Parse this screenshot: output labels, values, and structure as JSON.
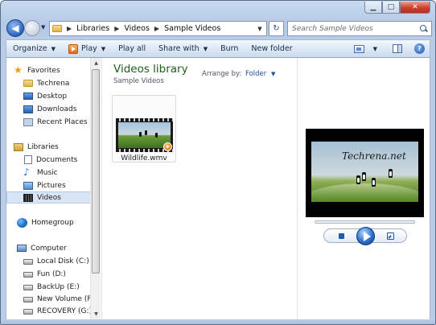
{
  "window": {
    "caption_buttons": [
      {
        "name": "minimize",
        "glyph": "▁"
      },
      {
        "name": "maximize",
        "glyph": "□"
      },
      {
        "name": "close",
        "glyph": "✕"
      }
    ]
  },
  "nav": {
    "back_glyph": "◀",
    "breadcrumbs": [
      "Libraries",
      "Videos",
      "Sample Videos"
    ],
    "breadcrumb_sep": "▶",
    "dropdown_glyph": "▼",
    "refresh_glyph": "↻",
    "search_placeholder": "Search Sample Videos"
  },
  "toolbar": {
    "organize": "Organize",
    "play": "Play",
    "play_all": "Play all",
    "share_with": "Share with",
    "burn": "Burn",
    "new_folder": "New folder",
    "caret": "▼",
    "help_glyph": "?"
  },
  "sidebar": {
    "groups": [
      {
        "label": "Favorites",
        "icon": "star-icon"
      },
      {
        "label": "Libraries",
        "icon": "library-icon"
      },
      {
        "label": "Homegroup",
        "icon": "homegroup-icon"
      },
      {
        "label": "Computer",
        "icon": "computer-icon"
      }
    ],
    "favorites": [
      {
        "label": "Techrena",
        "icon": "folder-icon"
      },
      {
        "label": "Desktop",
        "icon": "desktop-icon"
      },
      {
        "label": "Downloads",
        "icon": "downloads-icon"
      },
      {
        "label": "Recent Places",
        "icon": "recent-places-icon"
      }
    ],
    "libraries": [
      {
        "label": "Documents",
        "icon": "documents-icon"
      },
      {
        "label": "Music",
        "icon": "music-icon"
      },
      {
        "label": "Pictures",
        "icon": "pictures-icon"
      },
      {
        "label": "Videos",
        "icon": "videos-icon",
        "selected": true
      }
    ],
    "drives": [
      {
        "label": "Local Disk (C:)",
        "icon": "local-disk-icon"
      },
      {
        "label": "Fun (D:)",
        "icon": "drive-icon"
      },
      {
        "label": "BackUp (E:)",
        "icon": "drive-icon"
      },
      {
        "label": "New Volume (F:)",
        "icon": "drive-icon"
      },
      {
        "label": "RECOVERY (G:)",
        "icon": "drive-icon"
      }
    ],
    "scroll_up_glyph": "▲",
    "scroll_down_glyph": "▼"
  },
  "library": {
    "title": "Videos library",
    "subtitle": "Sample Videos",
    "arrange_label": "Arrange by:",
    "arrange_value": "Folder",
    "arrange_caret": "▼"
  },
  "files": [
    {
      "name": "Wildlife.wmv",
      "icon": "video-thumbnail-icon"
    }
  ],
  "preview": {
    "watermark": "Techrena.net"
  },
  "colors": {
    "library_title": "#1e5c1e",
    "accent_blue": "#1f4fa0",
    "selection": "#d9e5f4"
  }
}
